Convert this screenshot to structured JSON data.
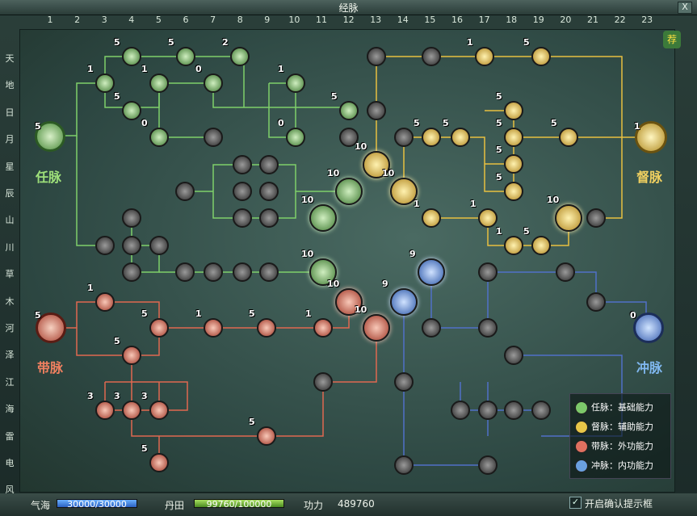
{
  "window": {
    "title": "经脉",
    "close_label": "X"
  },
  "columns": [
    "1",
    "2",
    "3",
    "4",
    "5",
    "6",
    "7",
    "8",
    "9",
    "10",
    "11",
    "12",
    "13",
    "14",
    "15",
    "16",
    "17",
    "18",
    "19",
    "20",
    "21",
    "22",
    "23"
  ],
  "rows": [
    "天",
    "地",
    "日",
    "月",
    "星",
    "辰",
    "山",
    "川",
    "草",
    "木",
    "河",
    "泽",
    "江",
    "海",
    "雷",
    "电",
    "风"
  ],
  "gates": {
    "ren": {
      "name": "任脉",
      "level": "5",
      "color": "#7cc86a"
    },
    "du": {
      "name": "督脉",
      "level": "1",
      "color": "#e8c648"
    },
    "dai": {
      "name": "带脉",
      "level": "5",
      "color": "#e07060"
    },
    "chong": {
      "name": "冲脉",
      "level": "0",
      "color": "#6aa0e0"
    }
  },
  "nodes": {
    "green": [
      "5",
      "5",
      "2",
      "1",
      "1",
      "0",
      "5",
      "0",
      "1",
      "0",
      "5",
      "10",
      "10",
      "10"
    ],
    "gold": [
      "1",
      "5",
      "5",
      "5",
      "5",
      "5",
      "5",
      "5",
      "5",
      "10",
      "10",
      "10",
      "1",
      "1",
      "1",
      "5"
    ],
    "red": [
      "1",
      "5",
      "1",
      "1",
      "5",
      "10",
      "10",
      "5",
      "3",
      "3",
      "3",
      "5",
      "5"
    ],
    "blue": [
      "9",
      "9"
    ]
  },
  "legend": {
    "items": [
      {
        "label": "任脉：基础能力",
        "color": "#7cc86a"
      },
      {
        "label": "督脉：辅助能力",
        "color": "#e8c648"
      },
      {
        "label": "带脉：外功能力",
        "color": "#e07060"
      },
      {
        "label": "冲脉：内功能力",
        "color": "#6aa0e0"
      }
    ]
  },
  "status": {
    "qihai_label": "气海",
    "qihai_value": "30000/30000",
    "qihai_fraction": 1.0,
    "dantian_label": "丹田",
    "dantian_value": "99760/100000",
    "dantian_fraction": 0.9976,
    "gongli_label": "功力",
    "gongli_value": "489760",
    "confirm_label": "开启确认提示框",
    "confirm_checked": true
  },
  "recommend_badge": "荐"
}
